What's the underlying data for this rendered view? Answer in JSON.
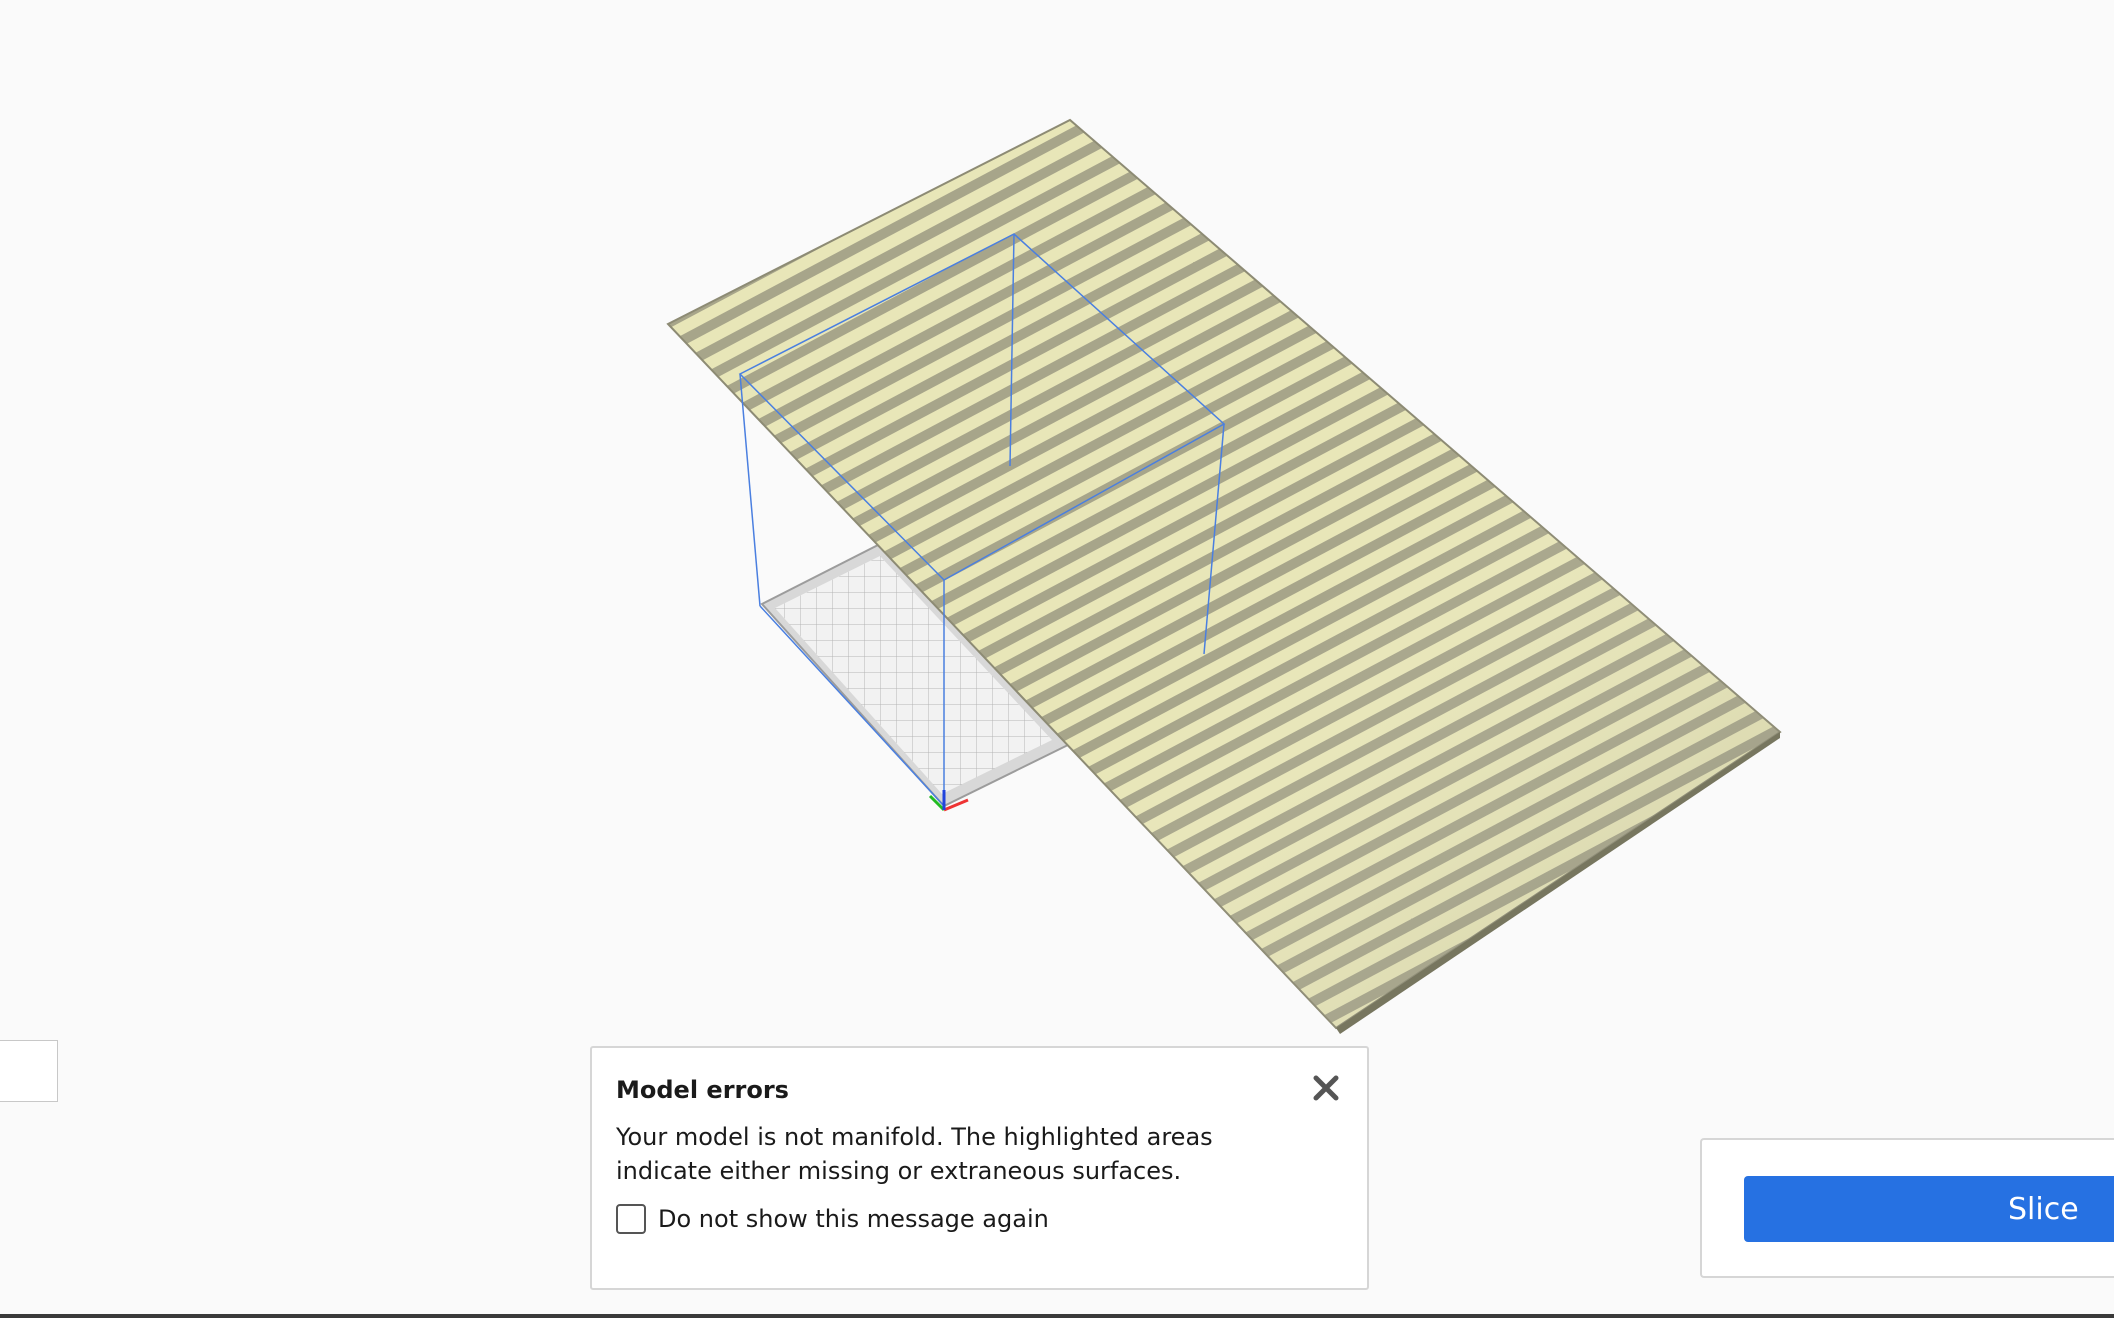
{
  "colors": {
    "viewport_bg": "#fafafa",
    "terrain_light": "#e8e6b8",
    "terrain_dark": "#a7a58a",
    "build_volume_line": "#4a7fe0",
    "build_plate": "#e9e9e9",
    "accent": "#2671e2"
  },
  "model_errors": {
    "title": "Model errors",
    "message": "Your model is not manifold. The highlighted areas indicate either missing or extraneous surfaces.",
    "checkbox_label": "Do not show this message again",
    "checkbox_checked": false,
    "close_icon": "close-icon"
  },
  "slice": {
    "button_label": "Slice"
  }
}
